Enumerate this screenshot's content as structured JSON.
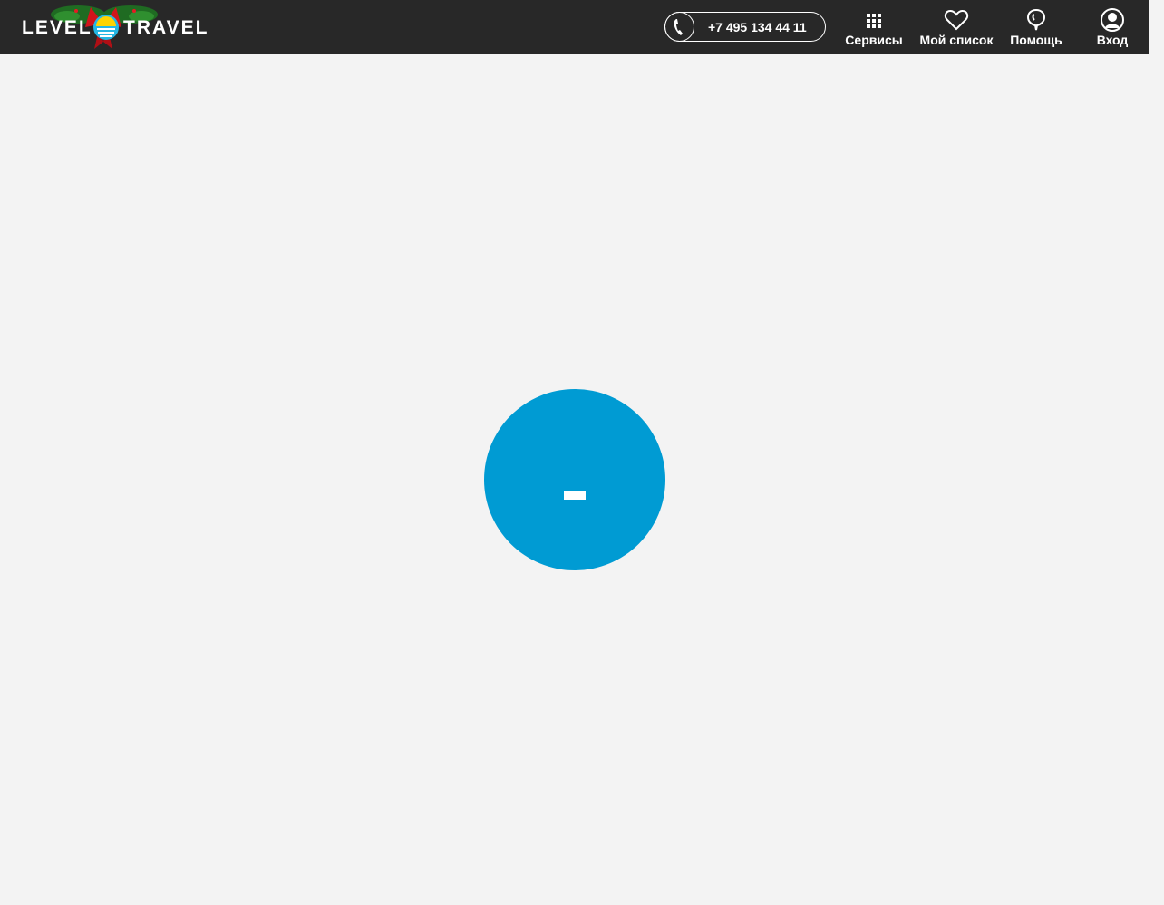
{
  "header": {
    "logo": {
      "left_text": "LEVEL",
      "right_text": "TRAVEL",
      "icon": "sun-over-sea-logo-icon"
    },
    "phone": {
      "number": "+7 495 134 44 11",
      "icon": "phone-icon"
    },
    "nav": {
      "services": {
        "label": "Сервисы",
        "icon": "grid-icon"
      },
      "my_list": {
        "label": "Мой список",
        "icon": "heart-icon"
      },
      "help": {
        "label": "Помощь",
        "icon": "help-bubble-icon"
      },
      "login": {
        "label": "Вход",
        "icon": "user-icon"
      }
    }
  },
  "main": {
    "loader": {
      "icon": "loading-indicator-icon"
    }
  },
  "colors": {
    "header_bg": "#282828",
    "page_bg": "#f3f3f3",
    "accent": "#009bd3",
    "header_text": "#ffffff"
  }
}
